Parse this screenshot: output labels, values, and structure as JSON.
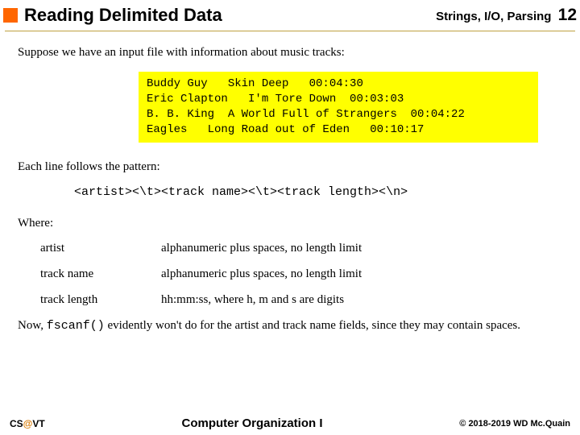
{
  "header": {
    "title": "Reading Delimited Data",
    "topic": "Strings, I/O, Parsing",
    "page_number": "12"
  },
  "content": {
    "lead": "Suppose we have an input file with information about music tracks:",
    "code_block": "Buddy Guy   Skin Deep   00:04:30\nEric Clapton   I'm Tore Down  00:03:03\nB. B. King  A World Full of Strangers  00:04:22\nEagles   Long Road out of Eden   00:10:17",
    "pattern_label": "Each line follows the pattern:",
    "pattern_code": "<artist><\\t><track name><\\t><track length><\\n>",
    "where_label": "Where:",
    "defs": [
      {
        "term": "artist",
        "desc": "alphanumeric plus spaces, no length limit"
      },
      {
        "term": "track name",
        "desc": "alphanumeric plus spaces, no length limit"
      },
      {
        "term": "track length",
        "desc": "hh:mm:ss, where h, m and s are digits"
      }
    ],
    "final_prefix": "Now, ",
    "final_mono": "fscanf()",
    "final_suffix": " evidently won't do for the artist and track name fields, since they may contain spaces."
  },
  "footer": {
    "left_cs": "CS",
    "left_at": "@",
    "left_vt": "VT",
    "center": "Computer Organization I",
    "right": "© 2018-2019 WD Mc.Quain"
  }
}
